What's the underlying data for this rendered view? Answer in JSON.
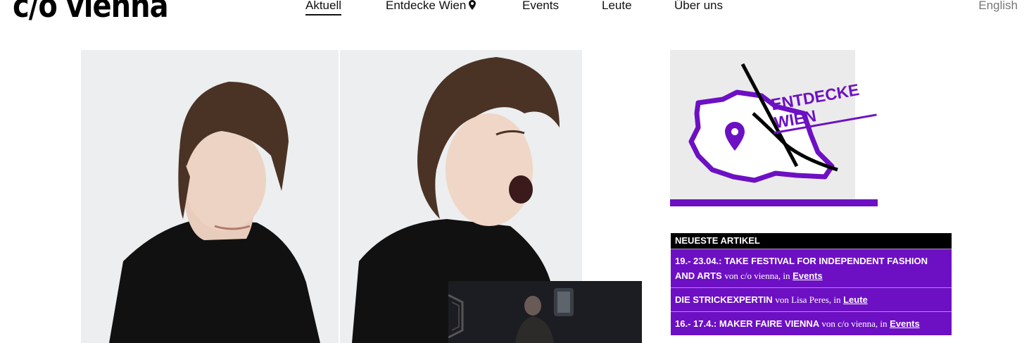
{
  "brand": {
    "logo_text": "c/o vienna"
  },
  "nav": {
    "items": [
      {
        "label": "Aktuell",
        "active": true
      },
      {
        "label": "Entdecke Wien",
        "icon": "map-pin-icon"
      },
      {
        "label": "Events"
      },
      {
        "label": "Leute"
      },
      {
        "label": "Über uns"
      }
    ],
    "language": "English"
  },
  "promo": {
    "line1": "ENTDECKE",
    "line2": "WIEN",
    "accent_color": "#6d10c4"
  },
  "articles": {
    "heading": "NEUESTE ARTIKEL",
    "items": [
      {
        "title": "19.- 23.04.: TAKE FESTIVAL FOR INDEPENDENT FASHION AND ARTS",
        "by": "von c/o vienna, in",
        "category": "Events"
      },
      {
        "title": "DIE STRICKEXPERTIN",
        "by": "von Lisa Peres, in",
        "category": "Leute"
      },
      {
        "title": "16.- 17.4.: MAKER FAIRE VIENNA",
        "by": "von c/o vienna, in",
        "category": "Events"
      }
    ]
  }
}
